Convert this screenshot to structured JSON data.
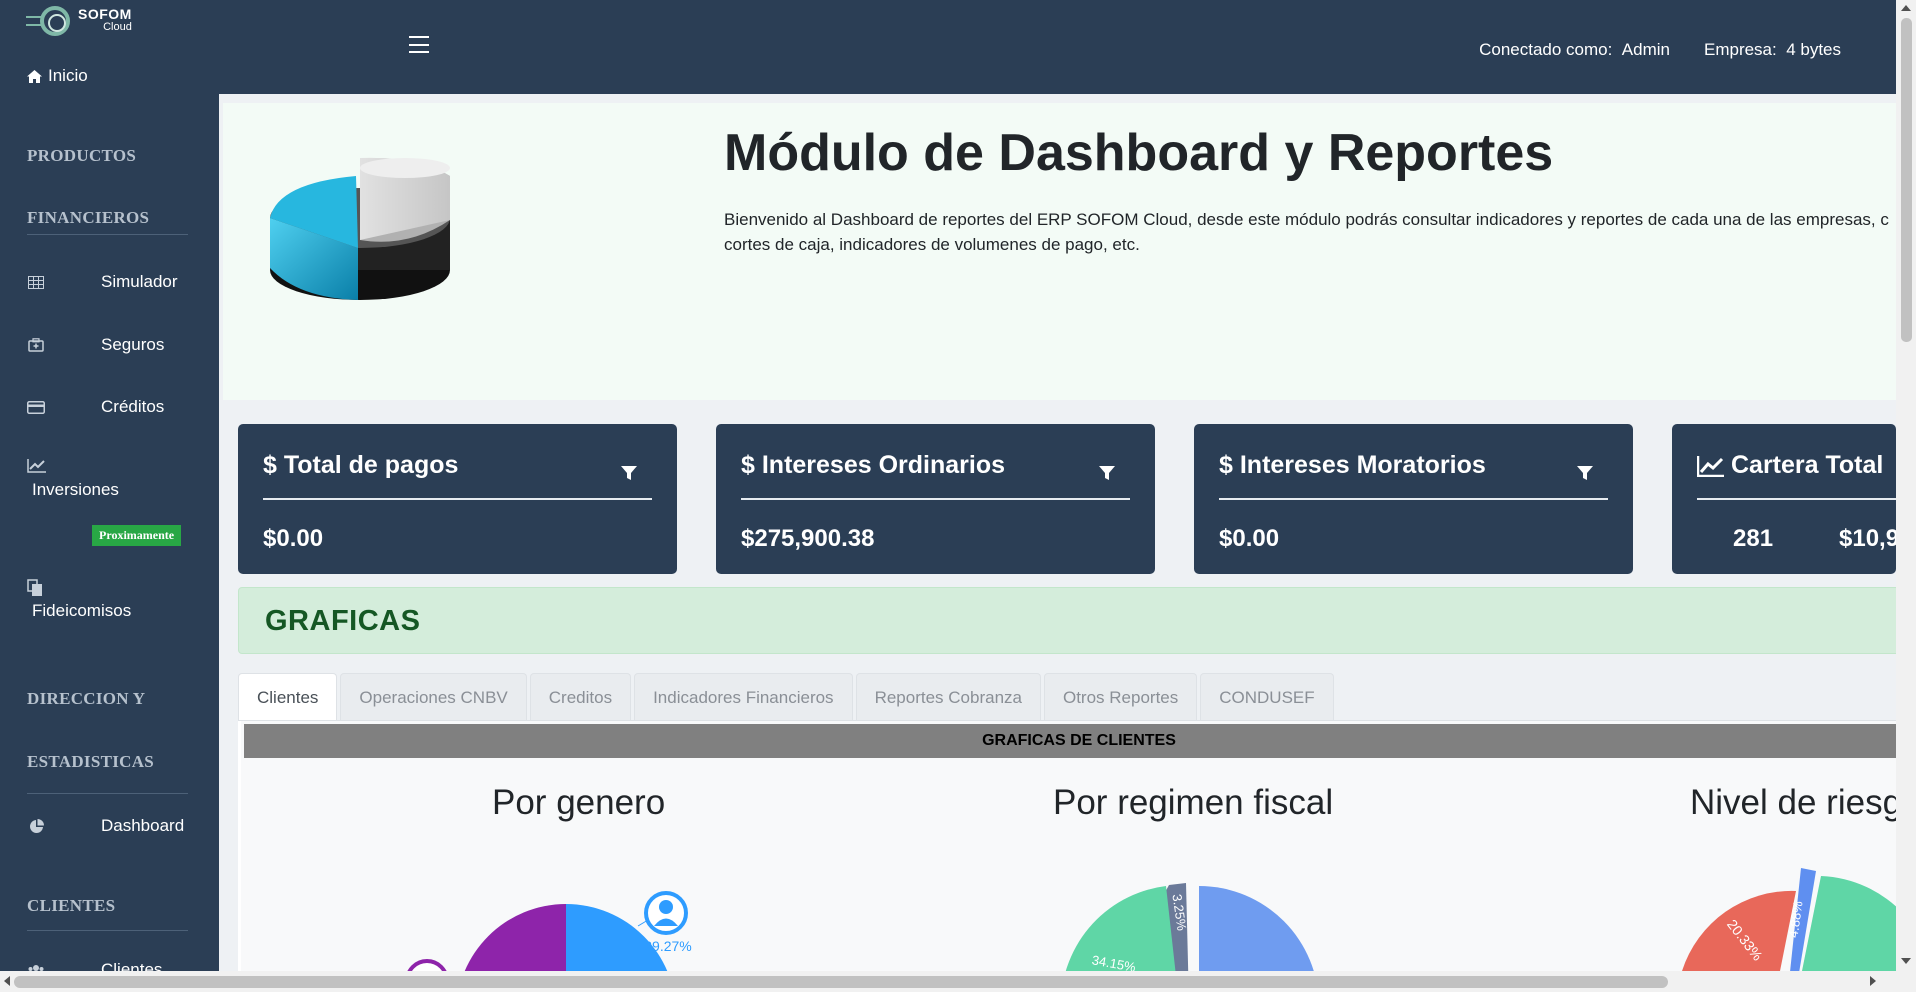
{
  "brand": {
    "name": "SOFOM",
    "sub": "Cloud"
  },
  "sidebar": {
    "home": "Inicio",
    "sections": [
      "PRODUCTOS",
      "FINANCIEROS",
      "DIRECCION Y",
      "ESTADISTICAS",
      "CLIENTES"
    ],
    "items": [
      {
        "label": "Simulador",
        "icon": "table-icon"
      },
      {
        "label": "Seguros",
        "icon": "briefcase-icon"
      },
      {
        "label": "Créditos",
        "icon": "credit-card-icon"
      },
      {
        "label": "Inversiones",
        "icon": "chart-line-icon"
      },
      {
        "label": "Fideicomisos",
        "icon": "copy-icon"
      },
      {
        "label": "Dashboard",
        "icon": "pie-chart-icon"
      },
      {
        "label": "Clientes",
        "icon": "users-icon"
      }
    ],
    "badge_soon": "Proximamente"
  },
  "header": {
    "connected_label": "Conectado como:",
    "user": "Admin",
    "company_label": "Empresa:",
    "company": "4 bytes"
  },
  "hero": {
    "title": "Módulo de Dashboard y Reportes",
    "description": "Bienvenido al Dashboard de reportes del ERP SOFOM Cloud, desde este módulo podrás consultar indicadores y reportes de cada una de las empresas, c cortes de caja, indicadores de volumenes de pago, etc."
  },
  "cards": [
    {
      "title": "$ Total de pagos",
      "value": "$0.00"
    },
    {
      "title": "$ Intereses Ordinarios",
      "value": "$275,900.38"
    },
    {
      "title": "$ Intereses Moratorios",
      "value": "$0.00"
    },
    {
      "title": "Cartera Total",
      "count": "281",
      "value": "$10,9"
    }
  ],
  "graficas": {
    "title": "GRAFICAS"
  },
  "tabs": [
    "Clientes",
    "Operaciones CNBV",
    "Creditos",
    "Indicadores Financieros",
    "Reportes Cobranza",
    "Otros Reportes",
    "CONDUSEF"
  ],
  "panel": {
    "header": "GRAFICAS DE CLIENTES",
    "chart_titles": [
      "Por genero",
      "Por regimen fiscal",
      "Nivel de riesg"
    ]
  },
  "chart_data": [
    {
      "type": "pie",
      "title": "Por genero",
      "labels": [
        "29.27%"
      ],
      "values": [
        29.27
      ],
      "colors": [
        "#2e9cff",
        "#8e24aa"
      ]
    },
    {
      "type": "pie",
      "title": "Por regimen fiscal",
      "labels": [
        "3.25%",
        "34.15%"
      ],
      "values": [
        3.25,
        34.15
      ],
      "colors": [
        "#6b7a99",
        "#5fd6a6",
        "#6f9cf0"
      ]
    },
    {
      "type": "pie",
      "title": "Nivel de riesg",
      "labels": [
        "20.33%",
        "4.88%"
      ],
      "values": [
        20.33,
        4.88
      ],
      "colors": [
        "#e8685a",
        "#5f8ff0",
        "#5fd6a6",
        "#f5c542"
      ]
    }
  ]
}
